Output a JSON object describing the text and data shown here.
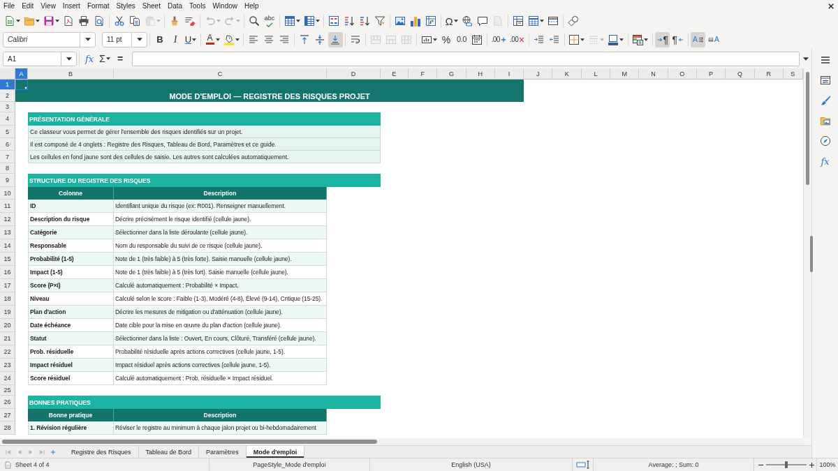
{
  "menu": [
    "File",
    "Edit",
    "View",
    "Insert",
    "Format",
    "Styles",
    "Sheet",
    "Data",
    "Tools",
    "Window",
    "Help"
  ],
  "standard_toolbar": [
    [
      {
        "kind": "new",
        "disabled": false
      },
      {
        "kind": "open",
        "disabled": false
      },
      {
        "kind": "save",
        "disabled": false
      },
      {
        "kind": "pdf",
        "disabled": false
      },
      {
        "kind": "print",
        "disabled": false
      },
      {
        "kind": "preview",
        "disabled": false
      }
    ],
    [
      {
        "kind": "cut",
        "disabled": false
      },
      {
        "kind": "copy",
        "disabled": false
      },
      {
        "kind": "paste",
        "disabled": true
      }
    ],
    [
      {
        "kind": "brush",
        "disabled": false
      },
      {
        "kind": "clear",
        "disabled": false
      }
    ],
    [
      {
        "kind": "undo",
        "disabled": true
      },
      {
        "kind": "redo",
        "disabled": true
      }
    ],
    [
      {
        "kind": "find",
        "disabled": false
      },
      {
        "kind": "spelling",
        "label": "abc",
        "disabled": false
      }
    ],
    [
      {
        "kind": "rows",
        "disabled": false
      },
      {
        "kind": "columns",
        "disabled": false
      }
    ],
    [
      {
        "kind": "sort",
        "disabled": false
      },
      {
        "kind": "ascending",
        "disabled": false
      },
      {
        "kind": "descending",
        "disabled": false
      },
      {
        "kind": "filter",
        "disabled": false
      }
    ],
    [
      {
        "kind": "image",
        "disabled": false
      },
      {
        "kind": "chart",
        "disabled": false
      },
      {
        "kind": "pivot",
        "disabled": false
      }
    ],
    [
      {
        "kind": "symbol",
        "label": "Ω",
        "disabled": false
      },
      {
        "kind": "link",
        "disabled": false
      },
      {
        "kind": "comment",
        "disabled": false
      },
      {
        "kind": "header",
        "disabled": true
      }
    ],
    [
      {
        "kind": "printarea",
        "disabled": false
      },
      {
        "kind": "freeze",
        "disabled": false
      },
      {
        "kind": "split",
        "disabled": false
      }
    ],
    [
      {
        "kind": "shapes",
        "disabled": false
      }
    ]
  ],
  "formatting_toolbar": {
    "font_name": "Calibri",
    "font_size": "11 pt",
    "groups": [
      [
        {
          "kind": "bold",
          "label": "B",
          "disabled": false,
          "pressed": false
        },
        {
          "kind": "italic",
          "label": "I",
          "disabled": false,
          "pressed": false
        },
        {
          "kind": "underline",
          "label": "U",
          "disabled": false,
          "pressed": false
        }
      ],
      [
        {
          "kind": "fontcolor",
          "label": "A",
          "disabled": false,
          "pressed": false
        },
        {
          "kind": "highlight",
          "disabled": false,
          "pressed": false
        }
      ],
      [
        {
          "kind": "left",
          "disabled": false,
          "pressed": false
        },
        {
          "kind": "center",
          "disabled": false,
          "pressed": false
        },
        {
          "kind": "right",
          "disabled": false,
          "pressed": false
        }
      ],
      [
        {
          "kind": "top",
          "disabled": false,
          "pressed": false
        },
        {
          "kind": "middle",
          "disabled": false,
          "pressed": false
        },
        {
          "kind": "bottom",
          "disabled": false,
          "pressed": true
        }
      ],
      [
        {
          "kind": "wrap",
          "disabled": false,
          "pressed": false
        }
      ],
      [
        {
          "kind": "mergecenter",
          "disabled": true,
          "pressed": false
        },
        {
          "kind": "merge",
          "disabled": true,
          "pressed": false
        },
        {
          "kind": "unmerge",
          "disabled": true,
          "pressed": false
        }
      ],
      [
        {
          "kind": "numformat",
          "disabled": false,
          "pressed": false
        },
        {
          "kind": "percent",
          "label": "%",
          "disabled": false,
          "pressed": false
        },
        {
          "kind": "decimal",
          "label": "0.0",
          "disabled": false,
          "pressed": false
        },
        {
          "kind": "date",
          "disabled": false,
          "pressed": false
        }
      ],
      [
        {
          "kind": "adddecimal",
          "label": ".00",
          "disabled": false,
          "pressed": false
        },
        {
          "kind": "deldecimal",
          "label": ".00",
          "disabled": false,
          "pressed": false
        }
      ],
      [
        {
          "kind": "indent",
          "disabled": false,
          "pressed": false
        },
        {
          "kind": "outdent",
          "disabled": false,
          "pressed": false
        }
      ],
      [
        {
          "kind": "borders",
          "disabled": false,
          "pressed": false
        },
        {
          "kind": "borderstyle",
          "disabled": true,
          "pressed": false
        },
        {
          "kind": "bordercolor",
          "disabled": false,
          "pressed": false
        }
      ],
      [
        {
          "kind": "conditional",
          "disabled": false,
          "pressed": false
        }
      ],
      [
        {
          "kind": "ltr",
          "label": "¶",
          "disabled": false,
          "pressed": true
        },
        {
          "kind": "rtl",
          "label": "¶",
          "disabled": false,
          "pressed": false
        }
      ],
      [
        {
          "kind": "horizontal",
          "label": "A",
          "disabled": false,
          "pressed": true
        },
        {
          "kind": "vertical",
          "label": "A",
          "disabled": false,
          "pressed": false
        }
      ]
    ]
  },
  "formula_bar": {
    "cell": "A1",
    "buttons": [
      {
        "kind": "wizard",
        "label": "fx"
      },
      {
        "kind": "sum",
        "label": "Σ"
      },
      {
        "kind": "formula",
        "label": "="
      }
    ]
  },
  "columns": [
    {
      "label": "A",
      "selected": true
    },
    {
      "label": "B",
      "selected": false
    },
    {
      "label": "C",
      "selected": false
    },
    {
      "label": "D",
      "selected": false
    },
    {
      "label": "E",
      "selected": false
    },
    {
      "label": "F",
      "selected": false
    },
    {
      "label": "G",
      "selected": false
    },
    {
      "label": "H",
      "selected": false
    },
    {
      "label": "I",
      "selected": false
    },
    {
      "label": "J",
      "selected": false
    },
    {
      "label": "K",
      "selected": false
    },
    {
      "label": "L",
      "selected": false
    },
    {
      "label": "M",
      "selected": false
    },
    {
      "label": "N",
      "selected": false
    },
    {
      "label": "O",
      "selected": false
    },
    {
      "label": "P",
      "selected": false
    },
    {
      "label": "Q",
      "selected": false
    },
    {
      "label": "R",
      "selected": false
    },
    {
      "label": "S",
      "selected": false
    }
  ],
  "rows": [
    {
      "label": "1",
      "selected": true
    },
    {
      "label": "2",
      "selected": false
    },
    {
      "label": "3",
      "selected": false
    },
    {
      "label": "4",
      "selected": false
    },
    {
      "label": "5",
      "selected": false
    },
    {
      "label": "6",
      "selected": false
    },
    {
      "label": "7",
      "selected": false
    },
    {
      "label": "8",
      "selected": false
    },
    {
      "label": "9",
      "selected": false
    },
    {
      "label": "10",
      "selected": false
    },
    {
      "label": "11",
      "selected": false
    },
    {
      "label": "12",
      "selected": false
    },
    {
      "label": "13",
      "selected": false
    },
    {
      "label": "14",
      "selected": false
    },
    {
      "label": "15",
      "selected": false
    },
    {
      "label": "16",
      "selected": false
    },
    {
      "label": "17",
      "selected": false
    },
    {
      "label": "18",
      "selected": false
    },
    {
      "label": "19",
      "selected": false
    },
    {
      "label": "20",
      "selected": false
    },
    {
      "label": "21",
      "selected": false
    },
    {
      "label": "22",
      "selected": false
    },
    {
      "label": "23",
      "selected": false
    },
    {
      "label": "24",
      "selected": false
    },
    {
      "label": "25",
      "selected": false
    },
    {
      "label": "26",
      "selected": false
    },
    {
      "label": "27",
      "selected": false
    },
    {
      "label": "28",
      "selected": false
    }
  ],
  "title": "MODE D'EMPLOI — REGISTRE DES RISQUES PROJET",
  "sections": [
    {
      "kind": "paragraphs",
      "heading": "PRÉSENTATION GÉNÉRALE",
      "lines": [
        "Ce classeur vous permet de gérer l'ensemble des risques identifiés sur un projet.",
        "Il est composé de 4 onglets : Registre des Risques, Tableau de Bord, Paramètres et ce guide.",
        "Les cellules en fond jaune sont des cellules de saisie. Les autres sont calculées automatiquement."
      ]
    },
    {
      "kind": "table",
      "heading": "STRUCTURE DU REGISTRE DES RISQUES",
      "columns": [
        "Colonne",
        "Description"
      ],
      "rows": [
        [
          "ID",
          "Identifiant unique du risque (ex: R001). Renseigner manuellement."
        ],
        [
          "Description du risque",
          "Décrire précisément le risque identifié (cellule jaune)."
        ],
        [
          "Catégorie",
          "Sélectionner dans la liste déroulante (cellule jaune)."
        ],
        [
          "Responsable",
          "Nom du responsable du suivi de ce risque (cellule jaune)."
        ],
        [
          "Probabilité (1-5)",
          "Note de 1 (très faible) à 5 (très forte). Saisie manuelle (cellule jaune)."
        ],
        [
          "Impact (1-5)",
          "Note de 1 (très faible) à 5 (très fort). Saisie manuelle (cellule jaune)."
        ],
        [
          "Score (P×I)",
          "Calculé automatiquement : Probabilité × Impact."
        ],
        [
          "Niveau",
          "Calculé selon le score : Faible (1-3), Modéré (4-8), Élevé (9-14), Critique (15-25)."
        ],
        [
          "Plan d'action",
          "Décrire les mesures de mitigation ou d'atténuation (cellule jaune)."
        ],
        [
          "Date échéance",
          "Date cible pour la mise en œuvre du plan d'action (cellule jaune)."
        ],
        [
          "Statut",
          "Sélectionner dans la liste : Ouvert, En cours, Clôturé, Transféré (cellule jaune)."
        ],
        [
          "Prob. résiduelle",
          "Probabilité résiduelle après actions correctives (cellule jaune, 1-5)."
        ],
        [
          "Impact résiduel",
          "Impact résiduel après actions correctives (cellule jaune, 1-5)."
        ],
        [
          "Score résiduel",
          "Calculé automatiquement : Prob. résiduelle × Impact résiduel."
        ]
      ]
    },
    {
      "kind": "table",
      "heading": "BONNES PRATIQUES",
      "columns": [
        "Bonne pratique",
        "Description"
      ],
      "rows": [
        [
          "1. Révision régulière",
          "Réviser le registre au minimum à chaque jalon projet ou bi-hebdomadairement"
        ]
      ]
    }
  ],
  "sheet_nav": [
    {
      "kind": "first",
      "disabled": true
    },
    {
      "kind": "prev",
      "disabled": true
    },
    {
      "kind": "next",
      "disabled": true
    },
    {
      "kind": "last",
      "disabled": true
    },
    {
      "kind": "addsheet",
      "disabled": false
    }
  ],
  "sheet_tabs": [
    {
      "label": "Registre des Risques",
      "selected": false
    },
    {
      "label": "Tableau de Bord",
      "selected": false
    },
    {
      "label": "Paramètres",
      "selected": false
    },
    {
      "label": "Mode d'emploi",
      "selected": true
    }
  ],
  "sidebar": [
    {
      "kind": "properties"
    },
    {
      "kind": "styles"
    },
    {
      "kind": "gallery"
    },
    {
      "kind": "navigator"
    },
    {
      "kind": "functions",
      "label": "fx"
    }
  ],
  "status_bar": {
    "sheet": "Sheet 4 of 4",
    "page_style": "PageStyle_Mode d'emploi",
    "language": "English (USA)",
    "summary": "Average: ; Sum: 0",
    "zoom_slider": {
      "level": 0.5
    },
    "zoom": "100%"
  }
}
